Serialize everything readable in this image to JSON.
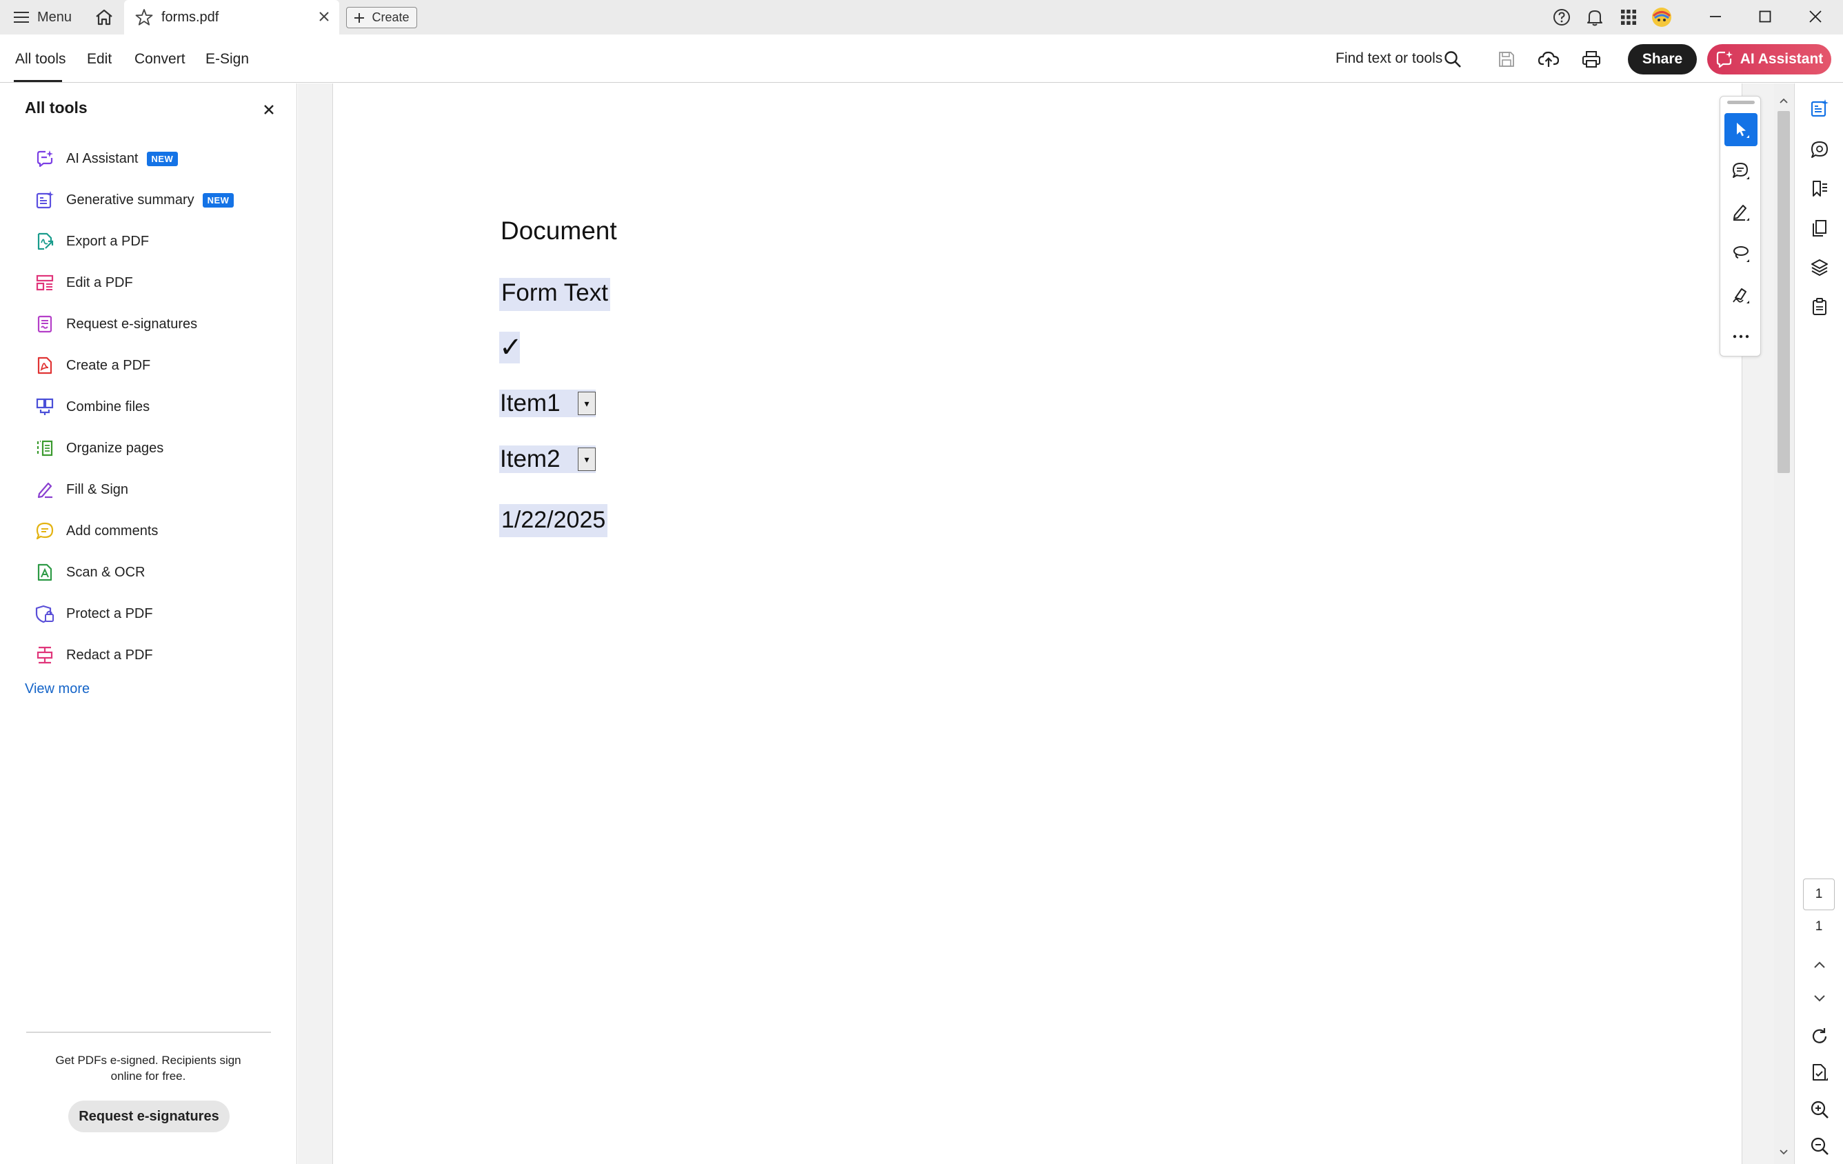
{
  "titlebar": {
    "menu_label": "Menu",
    "tab_title": "forms.pdf",
    "create_label": "Create"
  },
  "toolbar": {
    "tabs": [
      "All tools",
      "Edit",
      "Convert",
      "E-Sign"
    ],
    "find_label": "Find text or tools",
    "share_label": "Share",
    "ai_label": "AI Assistant"
  },
  "left_panel": {
    "title": "All tools",
    "items": [
      {
        "label": "AI Assistant",
        "badge": "NEW",
        "icon": "ai-assistant-icon",
        "color": "#7b3fe4"
      },
      {
        "label": "Generative summary",
        "badge": "NEW",
        "icon": "generative-summary-icon",
        "color": "#5b4fe0"
      },
      {
        "label": "Export a PDF",
        "badge": "",
        "icon": "export-pdf-icon",
        "color": "#1a9c8c"
      },
      {
        "label": "Edit a PDF",
        "badge": "",
        "icon": "edit-pdf-icon",
        "color": "#e0357a"
      },
      {
        "label": "Request e-signatures",
        "badge": "",
        "icon": "request-esign-icon",
        "color": "#b43fc8"
      },
      {
        "label": "Create a PDF",
        "badge": "",
        "icon": "create-pdf-icon",
        "color": "#e03434"
      },
      {
        "label": "Combine files",
        "badge": "",
        "icon": "combine-files-icon",
        "color": "#4a4fd8"
      },
      {
        "label": "Organize pages",
        "badge": "",
        "icon": "organize-pages-icon",
        "color": "#3a9a2e"
      },
      {
        "label": "Fill & Sign",
        "badge": "",
        "icon": "fill-sign-icon",
        "color": "#8a3fd0"
      },
      {
        "label": "Add comments",
        "badge": "",
        "icon": "add-comments-icon",
        "color": "#e3b312"
      },
      {
        "label": "Scan & OCR",
        "badge": "",
        "icon": "scan-ocr-icon",
        "color": "#2e9a46"
      },
      {
        "label": "Protect a PDF",
        "badge": "",
        "icon": "protect-pdf-icon",
        "color": "#5a4fd8"
      },
      {
        "label": "Redact a PDF",
        "badge": "",
        "icon": "redact-pdf-icon",
        "color": "#e0357a"
      }
    ],
    "view_more": "View more",
    "promo_text": "Get PDFs e-signed. Recipients sign online for free.",
    "promo_button": "Request e-signatures"
  },
  "document": {
    "heading": "Document",
    "form_text": "Form Text",
    "checkbox_mark": "✓",
    "combo1_value": "Item1",
    "combo2_value": "Item2",
    "combo_arrow": "▾",
    "date_value": "1/22/2025"
  },
  "navigation": {
    "current_page": "1",
    "total_pages": "1"
  },
  "colors": {
    "accent": "#1473e6",
    "ai_button": "#d6365a",
    "field_highlight": "#dfe4f5"
  }
}
